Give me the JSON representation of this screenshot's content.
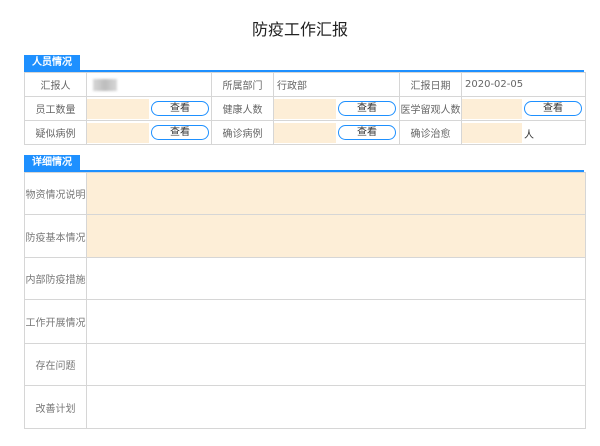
{
  "title": "防疫工作汇报",
  "sections": {
    "personnel": "人员情况",
    "details": "详细情况"
  },
  "labels": {
    "reporter": "汇报人",
    "department": "所属部门",
    "report_date": "汇报日期",
    "employee_count": "员工数量",
    "healthy_count": "健康人数",
    "observation_count": "医学留观人数",
    "suspected_cases": "疑似病例",
    "confirmed_cases": "确诊病例",
    "recovered": "确诊治愈"
  },
  "values": {
    "department": "行政部",
    "report_date": "2020-02-05",
    "recovered_unit": "人"
  },
  "view_button": "查看",
  "detail_rows": [
    "物资情况说明",
    "防疫基本情况",
    "内部防疫措施",
    "工作开展情况",
    "存在问题",
    "改善计划"
  ],
  "colors": {
    "accent": "#1e90ff",
    "highlight": "#fdeed7"
  }
}
